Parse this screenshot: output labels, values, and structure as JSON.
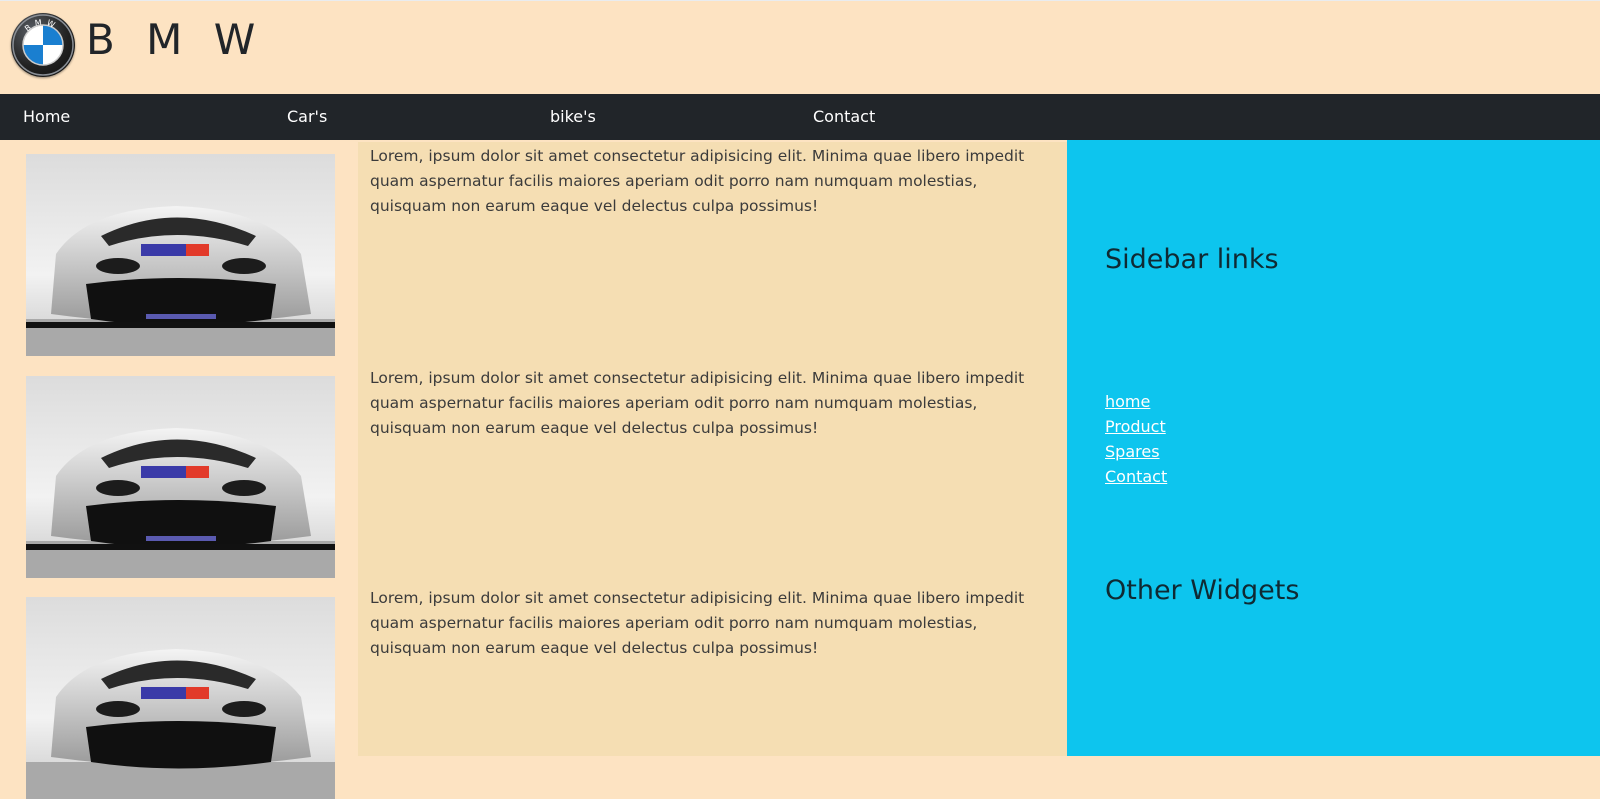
{
  "header": {
    "brand": "B M W",
    "logo_letters": "BMW"
  },
  "nav": {
    "items": [
      {
        "label": "Home"
      },
      {
        "label": "Car's"
      },
      {
        "label": "bike's"
      },
      {
        "label": "Contact"
      }
    ]
  },
  "main": {
    "posts": [
      {
        "image": "car-image",
        "text": "Lorem, ipsum dolor sit amet consectetur adipisicing elit. Minima quae libero impedit quam aspernatur facilis maiores aperiam odit porro nam numquam molestias, quisquam non earum eaque vel delectus culpa possimus!"
      },
      {
        "image": "car-image",
        "text": "Lorem, ipsum dolor sit amet consectetur adipisicing elit. Minima quae libero impedit quam aspernatur facilis maiores aperiam odit porro nam numquam molestias, quisquam non earum eaque vel delectus culpa possimus!"
      },
      {
        "image": "car-image",
        "text": "Lorem, ipsum dolor sit amet consectetur adipisicing elit. Minima quae libero impedit quam aspernatur facilis maiores aperiam odit porro nam numquam molestias, quisquam non earum eaque vel delectus culpa possimus!"
      }
    ]
  },
  "sidebar": {
    "links_heading": "Sidebar links",
    "links": [
      {
        "label": "home"
      },
      {
        "label": "Product"
      },
      {
        "label": "Spares"
      },
      {
        "label": "Contact"
      }
    ],
    "widgets_heading": "Other Widgets"
  },
  "colors": {
    "page_bg": "#fde3c2",
    "navbar_bg": "#212529",
    "content_bg": "#f5deb3",
    "sidebar_bg": "#0dc5ee"
  }
}
